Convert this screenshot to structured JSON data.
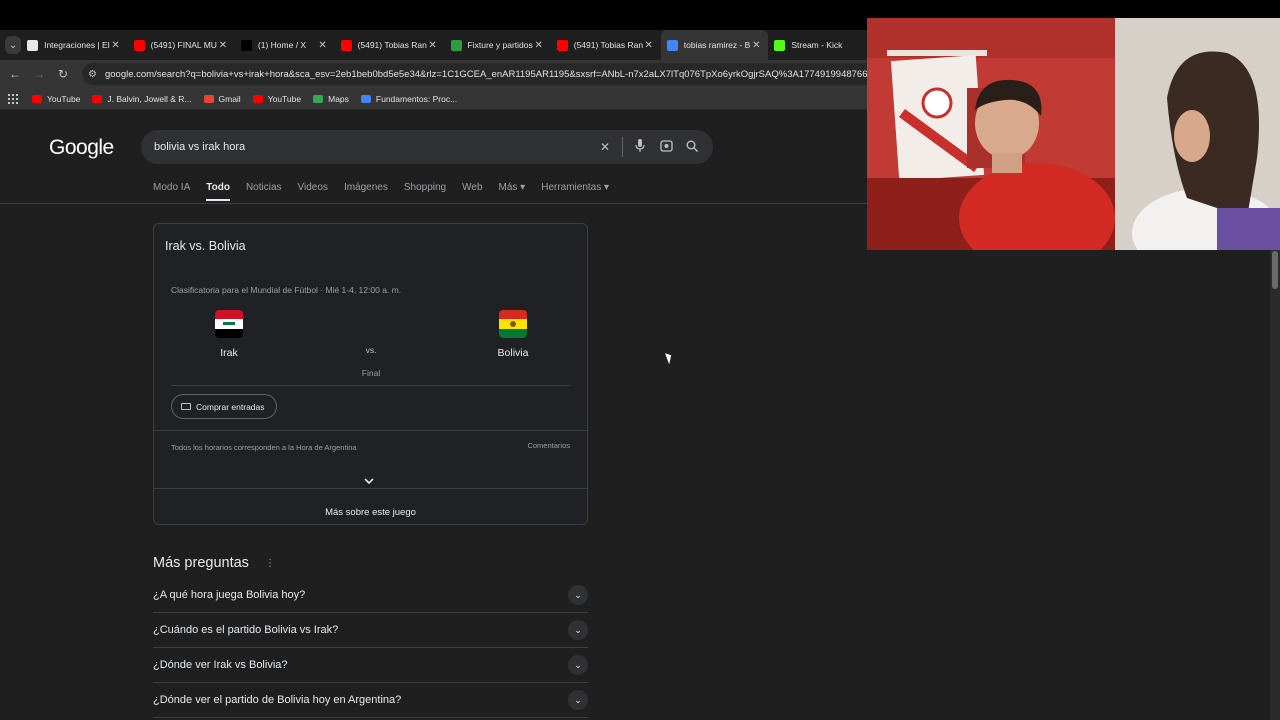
{
  "browser": {
    "tabs": [
      {
        "title": "Integraciones | El",
        "fav_color": "#e8e8e8"
      },
      {
        "title": "(5491) FINAL MU",
        "fav_color": "#ff0000"
      },
      {
        "title": "(1) Home / X",
        "fav_color": "#000000"
      },
      {
        "title": "(5491) Tobias Ran",
        "fav_color": "#ff0000"
      },
      {
        "title": "Fixture y partidos",
        "fav_color": "#2e9b3e"
      },
      {
        "title": "(5491) Tobias Ran",
        "fav_color": "#ff0000"
      },
      {
        "title": "tobias ramirez - B",
        "fav_color": "#4285f4"
      },
      {
        "title": "Stream - Kick",
        "fav_color": "#53fc18"
      }
    ],
    "url": "google.com/search?q=bolivia+vs+irak+hora&sca_esv=2eb1beb0bd5e5e34&rlz=1C1GCEA_enAR1195AR1195&sxsrf=ANbL-n7x2aLX7lTq076TpXo6yrkOgjrSAQ%3A1774919948766&ei=DQ",
    "bookmarks": [
      {
        "label": "YouTube",
        "color": "#ff0000"
      },
      {
        "label": "J. Balvin, Jowell & R...",
        "color": "#ff0000"
      },
      {
        "label": "Gmail",
        "color": "#ea4335"
      },
      {
        "label": "YouTube",
        "color": "#ff0000"
      },
      {
        "label": "Maps",
        "color": "#34a853"
      },
      {
        "label": "Fundamentos: Proc...",
        "color": "#4285f4"
      }
    ]
  },
  "google": {
    "logo": "Google",
    "query": "bolivia vs irak hora",
    "tabs": [
      "Modo IA",
      "Todo",
      "Noticias",
      "Videos",
      "Imágenes",
      "Shopping",
      "Web",
      "Más ▾",
      "Herramientas ▾"
    ],
    "active_tab_index": 1
  },
  "match": {
    "title": "Irak vs. Bolivia",
    "subtitle": "Clasificatoria para el Mundial de Fútbol · Mié 1-4, 12:00 a. m.",
    "team_home": "Irak",
    "team_away": "Bolivia",
    "vs": "vs.",
    "status": "Final",
    "buy_label": "Comprar entradas",
    "footnote": "Todos los horarios corresponden a la Hora de Argentina",
    "comments": "Comentarios",
    "more": "Más sobre este juego"
  },
  "more_questions": {
    "title": "Más preguntas",
    "items": [
      "¿A qué hora juega Bolivia hoy?",
      "¿Cuándo es el partido Bolivia vs Irak?",
      "¿Dónde ver Irak vs Bolivia?",
      "¿Dónde ver el partido de Bolivia hoy en Argentina?"
    ]
  }
}
